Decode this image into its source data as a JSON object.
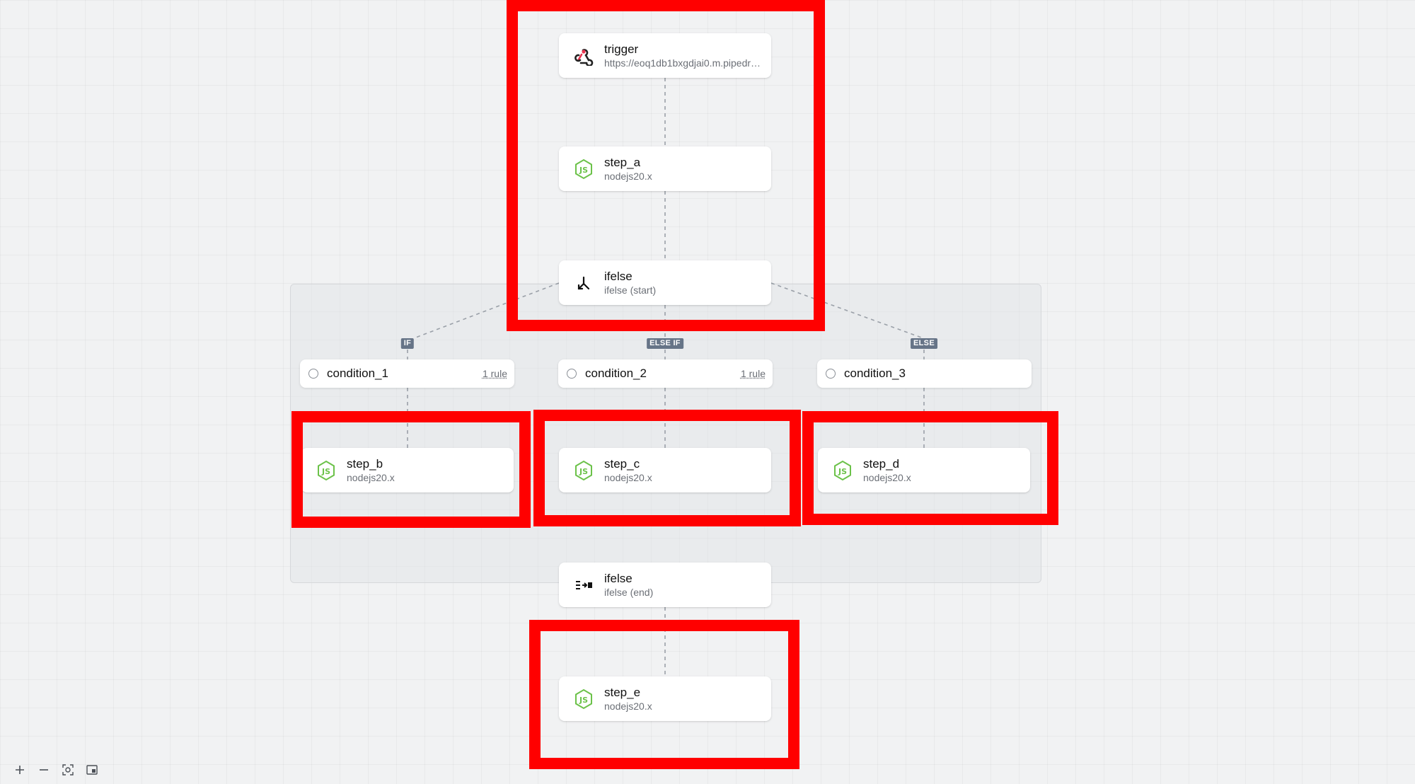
{
  "nodes": {
    "trigger": {
      "title": "trigger",
      "subtitle": "https://eoq1db1bxgdjai0.m.pipedream.net",
      "icon": "webhook-icon"
    },
    "step_a": {
      "title": "step_a",
      "subtitle": "nodejs20.x",
      "icon": "nodejs-icon"
    },
    "ifelse_start": {
      "title": "ifelse",
      "subtitle": "ifelse (start)",
      "icon": "branch-icon"
    },
    "step_b": {
      "title": "step_b",
      "subtitle": "nodejs20.x",
      "icon": "nodejs-icon"
    },
    "step_c": {
      "title": "step_c",
      "subtitle": "nodejs20.x",
      "icon": "nodejs-icon"
    },
    "step_d": {
      "title": "step_d",
      "subtitle": "nodejs20.x",
      "icon": "nodejs-icon"
    },
    "ifelse_end": {
      "title": "ifelse",
      "subtitle": "ifelse (end)",
      "icon": "merge-icon"
    },
    "step_e": {
      "title": "step_e",
      "subtitle": "nodejs20.x",
      "icon": "nodejs-icon"
    }
  },
  "conditions": {
    "c1": {
      "label": "condition_1",
      "rules": "1 rule"
    },
    "c2": {
      "label": "condition_2",
      "rules": "1 rule"
    },
    "c3": {
      "label": "condition_3",
      "rules": ""
    }
  },
  "badges": {
    "if": "IF",
    "elseif": "ELSE IF",
    "else": "ELSE"
  },
  "toolbar": {
    "zoom_in": "zoom-in-icon",
    "zoom_out": "zoom-out-icon",
    "fit": "fit-view-icon",
    "minimap": "minimap-icon"
  },
  "colors": {
    "highlight": "#ff0000",
    "node_green": "#6cc24a",
    "badge": "#667487",
    "trigger_red": "#e8344e"
  }
}
